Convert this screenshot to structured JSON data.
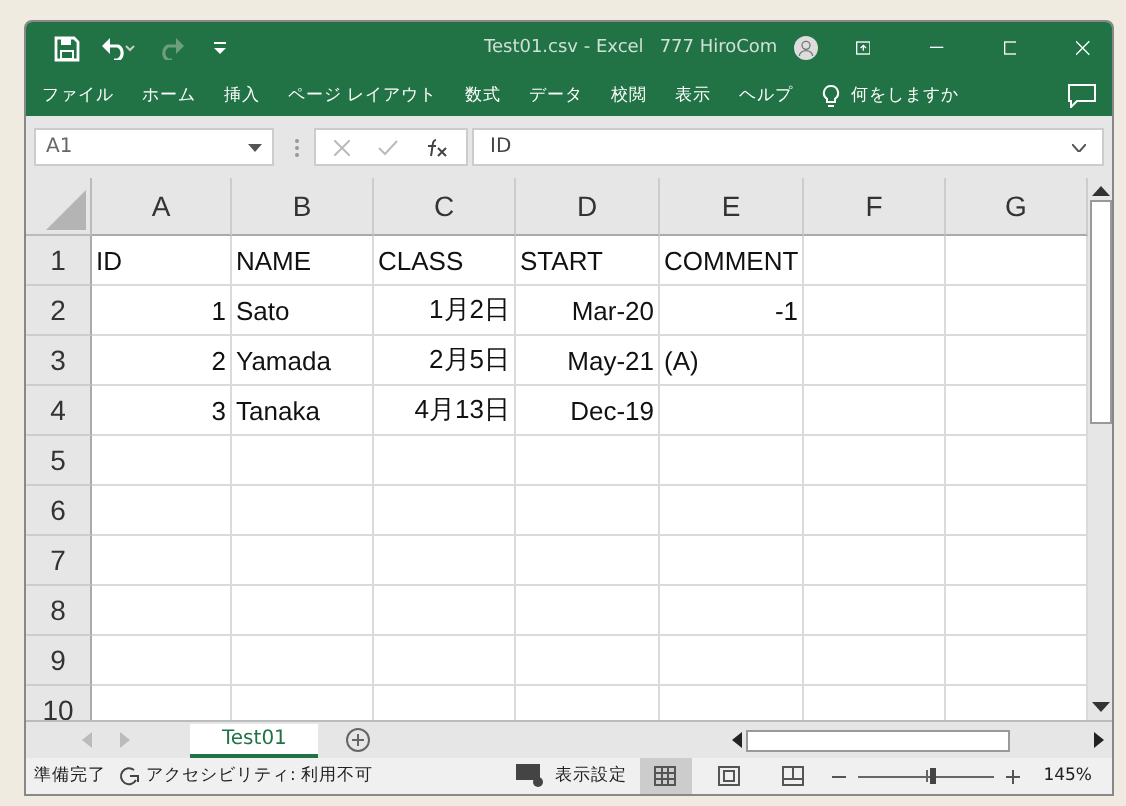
{
  "window": {
    "title": "Test01.csv  -  Excel",
    "user": "777 HiroCom"
  },
  "ribbon_tabs": [
    "ファイル",
    "ホーム",
    "挿入",
    "ページ レイアウト",
    "数式",
    "データ",
    "校閲",
    "表示",
    "ヘルプ"
  ],
  "tell_me": "何をしますか",
  "name_box": "A1",
  "formula": "ID",
  "columns": [
    "A",
    "B",
    "C",
    "D",
    "E",
    "F",
    "G"
  ],
  "rows": [
    {
      "header": "1",
      "cells": [
        {
          "text": "ID",
          "kind": "text"
        },
        {
          "text": "NAME",
          "kind": "text"
        },
        {
          "text": "CLASS",
          "kind": "text"
        },
        {
          "text": "START",
          "kind": "text"
        },
        {
          "text": "COMMENT",
          "kind": "text"
        }
      ]
    },
    {
      "header": "2",
      "cells": [
        {
          "text": "1",
          "kind": "number"
        },
        {
          "text": "Sato",
          "kind": "text"
        },
        {
          "text": "1月2日",
          "kind": "number"
        },
        {
          "text": "Mar-20",
          "kind": "number"
        },
        {
          "text": "-1",
          "kind": "number"
        }
      ]
    },
    {
      "header": "3",
      "cells": [
        {
          "text": "2",
          "kind": "number"
        },
        {
          "text": "Yamada",
          "kind": "text"
        },
        {
          "text": "2月5日",
          "kind": "number"
        },
        {
          "text": "May-21",
          "kind": "number"
        },
        {
          "text": "(A)",
          "kind": "text"
        }
      ]
    },
    {
      "header": "4",
      "cells": [
        {
          "text": "3",
          "kind": "number"
        },
        {
          "text": "Tanaka",
          "kind": "text"
        },
        {
          "text": "4月13日",
          "kind": "number"
        },
        {
          "text": "Dec-19",
          "kind": "number"
        }
      ]
    },
    {
      "header": "5",
      "cells": []
    },
    {
      "header": "6",
      "cells": []
    },
    {
      "header": "7",
      "cells": []
    },
    {
      "header": "8",
      "cells": []
    },
    {
      "header": "9",
      "cells": []
    },
    {
      "header": "10",
      "cells": []
    }
  ],
  "sheet_tabs": [
    {
      "label": "Test01",
      "selected": true
    }
  ],
  "status": {
    "ready": "準備完了",
    "accessibility": "アクセシビリティ: 利用不可",
    "display_settings": "表示設定",
    "zoom": "145%",
    "zoom_slider": {
      "level": 0.56
    }
  }
}
